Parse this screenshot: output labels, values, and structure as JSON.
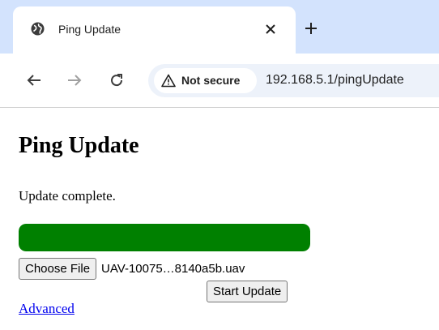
{
  "browser": {
    "tab": {
      "title": "Ping Update",
      "favicon": "globe-icon",
      "close_icon": "close-icon"
    },
    "new_tab_icon": "plus-icon",
    "nav": {
      "back_icon": "arrow-left-icon",
      "forward_icon": "arrow-right-icon",
      "reload_icon": "reload-icon"
    },
    "omnibox": {
      "security_icon": "warning-triangle-icon",
      "security_label": "Not secure",
      "url": "192.168.5.1/pingUpdate"
    },
    "colors": {
      "tabstrip": "#d3e3fd",
      "omnibox": "#edf2fa"
    }
  },
  "page": {
    "title": "Ping Update",
    "status": "Update complete.",
    "progress": {
      "percent": 100,
      "color": "#008000"
    },
    "file_input": {
      "button_label": "Choose File",
      "file_name": "UAV-10075…8140a5b.uav"
    },
    "start_button_label": "Start Update",
    "advanced_link": "Advanced"
  }
}
